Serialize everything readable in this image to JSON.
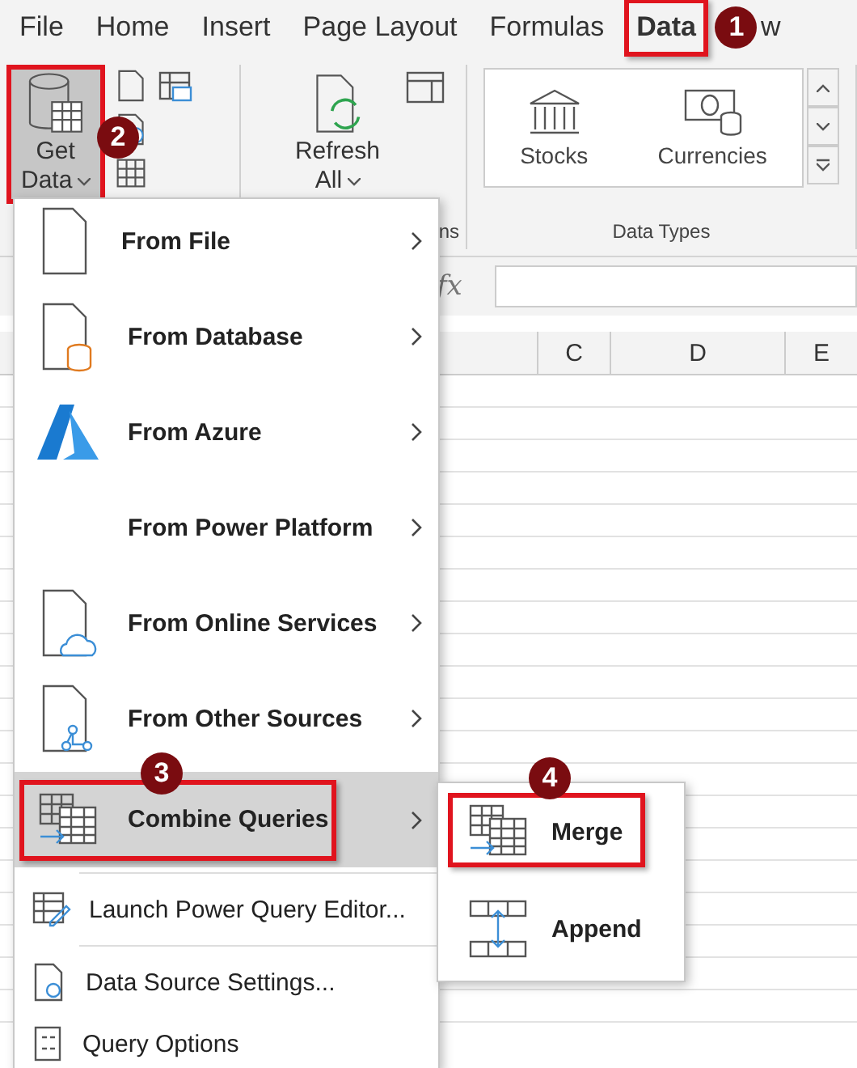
{
  "tabs": [
    {
      "label": "File",
      "selected": false,
      "annotated": false
    },
    {
      "label": "Home",
      "selected": false,
      "annotated": false
    },
    {
      "label": "Insert",
      "selected": false,
      "annotated": false
    },
    {
      "label": "Page Layout",
      "selected": false,
      "annotated": false
    },
    {
      "label": "Formulas",
      "selected": false,
      "annotated": false
    },
    {
      "label": "Data",
      "selected": true,
      "annotated": true,
      "callout": "1"
    }
  ],
  "cut_tab": "w",
  "ribbon": {
    "get_data": {
      "line1": "Get",
      "line2": "Data",
      "annotated": true,
      "callout": "2"
    },
    "refresh": {
      "line1": "Refresh",
      "line2": "All"
    },
    "cut_group_label": "ns",
    "data_types": {
      "label": "Data Types",
      "items": [
        "Stocks",
        "Currencies"
      ]
    }
  },
  "formula_bar": {
    "fx": "fx"
  },
  "columns": [
    "C",
    "D",
    "E"
  ],
  "menu": [
    {
      "label": "From File",
      "kind": "file",
      "submenu": true,
      "selected": false,
      "annotated": false
    },
    {
      "label": "From Database",
      "kind": "database",
      "submenu": true,
      "selected": false,
      "annotated": false
    },
    {
      "label": "From Azure",
      "kind": "azure",
      "submenu": true,
      "selected": false,
      "annotated": false
    },
    {
      "label": "From Power Platform",
      "kind": "none",
      "submenu": true,
      "selected": false,
      "annotated": false
    },
    {
      "label": "From Online Services",
      "kind": "cloud",
      "submenu": true,
      "selected": false,
      "annotated": false
    },
    {
      "label": "From Other Sources",
      "kind": "other",
      "submenu": true,
      "selected": false,
      "annotated": false
    },
    {
      "label": "Combine Queries",
      "kind": "combine",
      "submenu": true,
      "selected": true,
      "annotated": true,
      "callout": "3"
    },
    {
      "label": "Launch Power Query Editor...",
      "kind": "editor",
      "submenu": false,
      "selected": false,
      "annotated": false
    },
    {
      "label": "Data Source Settings...",
      "kind": "settings",
      "submenu": false,
      "selected": false,
      "annotated": false
    },
    {
      "label": "Query Options",
      "kind": "options",
      "submenu": false,
      "selected": false,
      "annotated": false
    }
  ],
  "submenu": [
    {
      "label": "Merge",
      "kind": "merge",
      "annotated": true,
      "callout": "4"
    },
    {
      "label": "Append",
      "kind": "append",
      "annotated": false
    }
  ]
}
